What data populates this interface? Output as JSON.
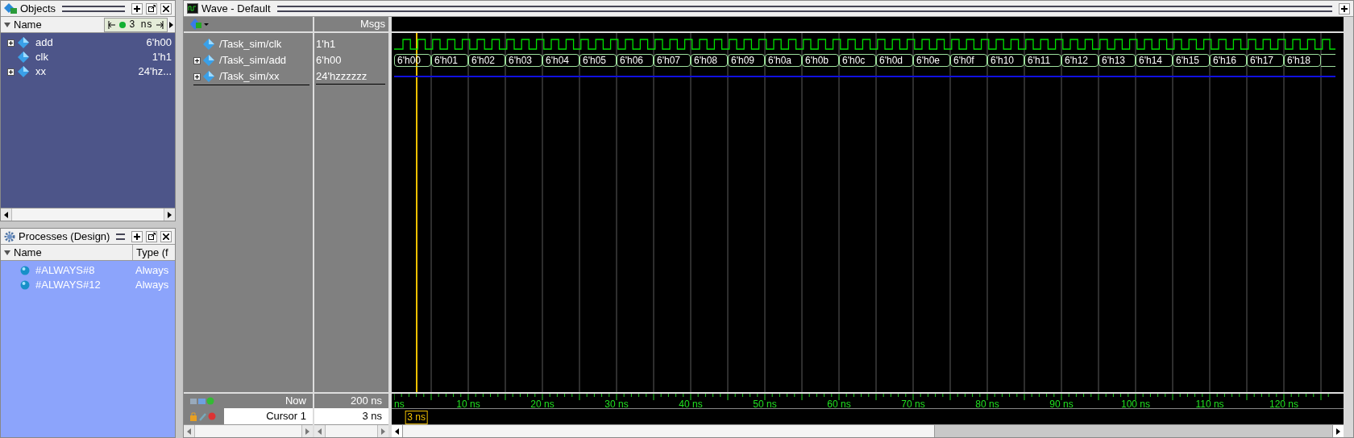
{
  "objects_panel": {
    "title": "Objects",
    "column": "Name",
    "time_badge": "3 ns",
    "items": [
      {
        "name": "add",
        "value": "6'h00",
        "expandable": true
      },
      {
        "name": "clk",
        "value": "1'h1",
        "expandable": false
      },
      {
        "name": "xx",
        "value": "24'hz...",
        "expandable": true
      }
    ]
  },
  "processes_panel": {
    "title": "Processes (Design)",
    "columns": [
      "Name",
      "Type (f"
    ],
    "items": [
      {
        "name": "#ALWAYS#8",
        "type": "Always"
      },
      {
        "name": "#ALWAYS#12",
        "type": "Always"
      }
    ]
  },
  "wave_window": {
    "title": "Wave - Default",
    "msgs_header": "Msgs",
    "signals": [
      {
        "kind": "clock",
        "name": "/Task_sim/clk",
        "value": "1'h1",
        "expandable": false
      },
      {
        "kind": "bus",
        "name": "/Task_sim/add",
        "value": "6'h00",
        "expandable": true,
        "segments": [
          "6'h00",
          "6'h01",
          "6'h02",
          "6'h03",
          "6'h04",
          "6'h05",
          "6'h06",
          "6'h07",
          "6'h08",
          "6'h09",
          "6'h0a",
          "6'h0b",
          "6'h0c",
          "6'h0d",
          "6'h0e",
          "6'h0f",
          "6'h10",
          "6'h11",
          "6'h12",
          "6'h13",
          "6'h14",
          "6'h15",
          "6'h16",
          "6'h17",
          "6'h18"
        ]
      },
      {
        "kind": "highz",
        "name": "/Task_sim/xx",
        "value": "24'hzzzzzz",
        "expandable": true
      }
    ],
    "now_label": "Now",
    "now_value": "200 ns",
    "cursor_label": "Cursor 1",
    "cursor_value": "3 ns",
    "cursor_marker": "3 ns",
    "time_labels": [
      "ns",
      "10 ns",
      "20 ns",
      "30 ns",
      "40 ns",
      "50 ns",
      "60 ns",
      "70 ns",
      "80 ns",
      "90 ns",
      "100 ns",
      "110 ns",
      "120 ns"
    ]
  }
}
